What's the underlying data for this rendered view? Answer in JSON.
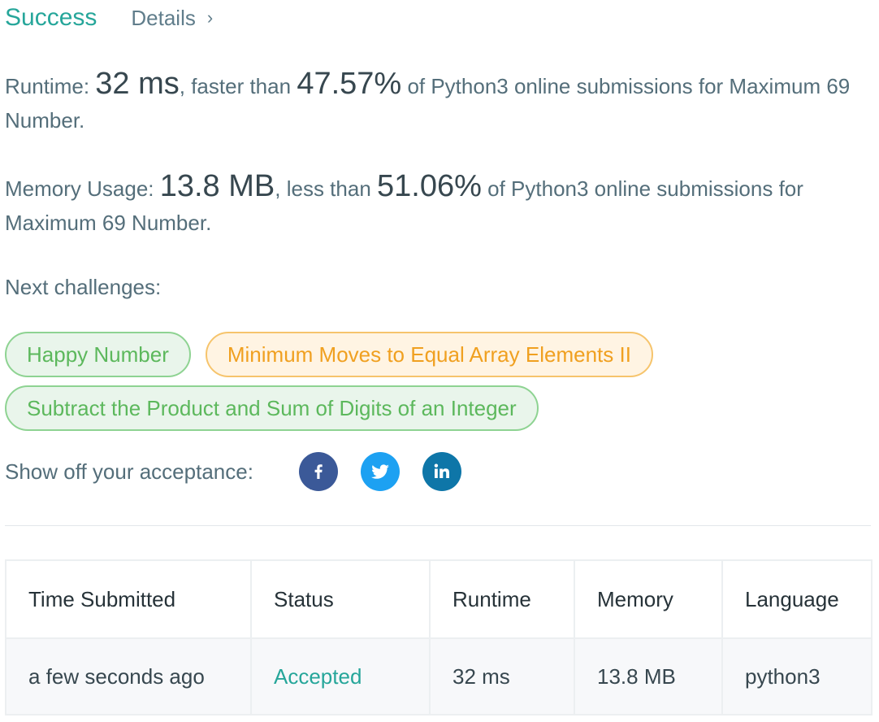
{
  "header": {
    "status": "Success",
    "details_label": "Details",
    "details_chevron": "›"
  },
  "runtime": {
    "label": "Runtime:",
    "value": "32 ms",
    "mid": ", faster than",
    "percent": "47.57%",
    "suffix": "of Python3 online submissions for Maximum 69 Number."
  },
  "memory": {
    "label": "Memory Usage:",
    "value": "13.8 MB",
    "mid": ", less than",
    "percent": "51.06%",
    "suffix": "of Python3 online submissions for Maximum 69 Number."
  },
  "next": {
    "label": "Next challenges:",
    "items": [
      {
        "title": "Happy Number",
        "difficulty": "easy",
        "color": "#5cb85c"
      },
      {
        "title": "Minimum Moves to Equal Array Elements II",
        "difficulty": "medium",
        "color": "#f0a020"
      },
      {
        "title": "Subtract the Product and Sum of Digits of an Integer",
        "difficulty": "easy",
        "color": "#5cb85c"
      }
    ]
  },
  "share": {
    "label": "Show off your acceptance:",
    "icons": [
      "facebook-icon",
      "twitter-icon",
      "linkedin-icon"
    ],
    "colors": {
      "facebook": "#3b5998",
      "twitter": "#1da1f2",
      "linkedin": "#0e76a8"
    }
  },
  "table": {
    "headers": [
      "Time Submitted",
      "Status",
      "Runtime",
      "Memory",
      "Language"
    ],
    "rows": [
      [
        "a few seconds ago",
        "Accepted",
        "32 ms",
        "13.8 MB",
        "python3"
      ]
    ]
  },
  "colors": {
    "success": "#26a69a",
    "text": "#546e7a"
  }
}
